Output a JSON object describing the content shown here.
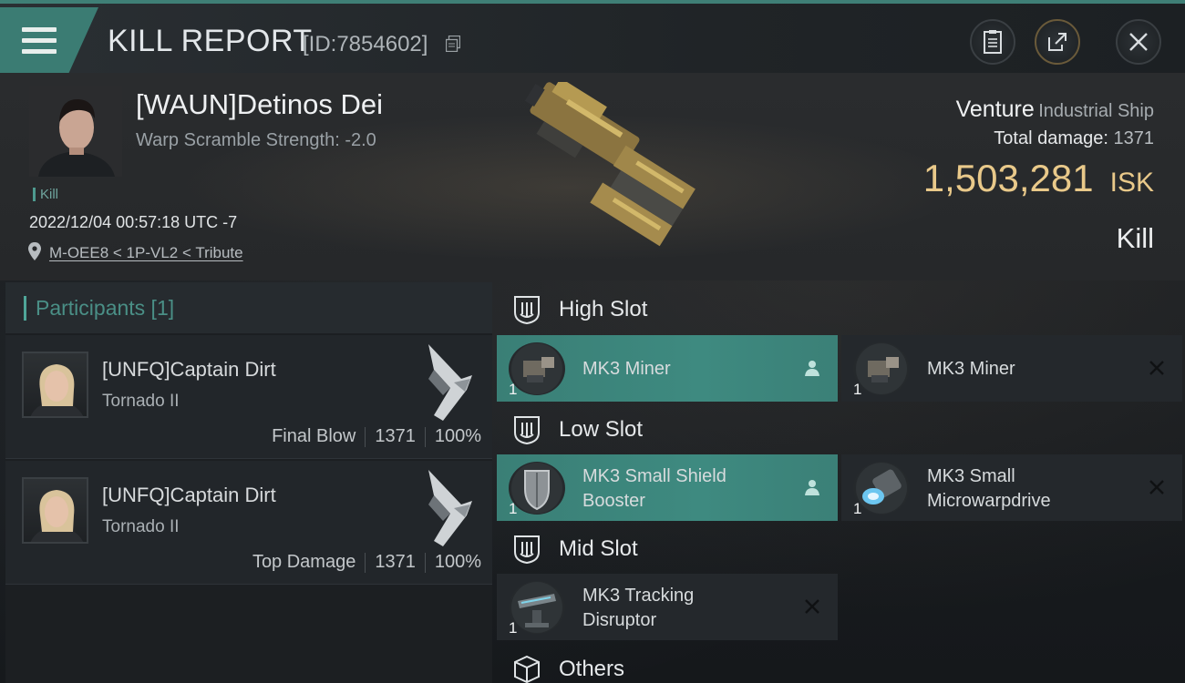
{
  "app": {
    "title": "KILL REPORT",
    "report_id": "[ID:7854602]"
  },
  "victim": {
    "name": "[WAUN]Detinos Dei",
    "warp_scramble": "Warp Scramble Strength: -2.0",
    "tag": "Kill",
    "datetime": "2022/12/04 00:57:18 UTC -7",
    "location": "M-OEE8 < 1P-VL2 < Tribute",
    "ship_name": "Venture",
    "ship_class": "Industrial Ship",
    "total_damage_label": "Total damage:",
    "total_damage_value": "1371",
    "isk_amount": "1,503,281",
    "isk_unit": "ISK",
    "result": "Kill"
  },
  "participants": {
    "header_label": "Participants [1]",
    "rows": [
      {
        "name": "[UNFQ]Captain Dirt",
        "ship": "Tornado II",
        "role": "Final Blow",
        "damage": "1371",
        "percent": "100%"
      },
      {
        "name": "[UNFQ]Captain Dirt",
        "ship": "Tornado II",
        "role": "Top Damage",
        "damage": "1371",
        "percent": "100%"
      }
    ]
  },
  "fitting": {
    "high_slot": {
      "label": "High Slot",
      "modules": [
        {
          "name": "MK3 Miner",
          "qty": "1",
          "status": "dropped"
        },
        {
          "name": "MK3 Miner",
          "qty": "1",
          "status": "destroyed"
        }
      ]
    },
    "low_slot": {
      "label": "Low Slot",
      "modules": [
        {
          "name_line1": "MK3 Small Shield",
          "name_line2": "Booster",
          "qty": "1",
          "status": "dropped"
        },
        {
          "name_line1": "MK3 Small",
          "name_line2": "Microwarpdrive",
          "qty": "1",
          "status": "destroyed"
        }
      ]
    },
    "mid_slot": {
      "label": "Mid Slot",
      "modules": [
        {
          "name_line1": "MK3 Tracking",
          "name_line2": "Disruptor",
          "qty": "1",
          "status": "destroyed"
        }
      ]
    },
    "others": {
      "label": "Others"
    }
  },
  "colors": {
    "accent": "#3b7c73",
    "isk": "#e9c98a",
    "highlight": "#3e8a80"
  }
}
